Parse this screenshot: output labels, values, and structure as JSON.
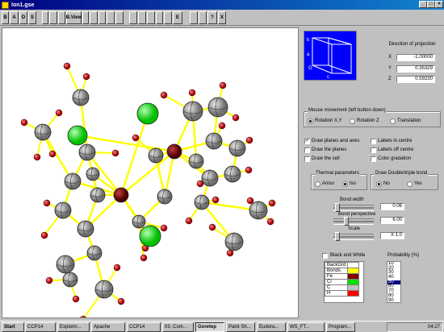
{
  "window": {
    "title": "lon1.gse"
  },
  "toolbar": {
    "buttons": [
      {
        "label": "B",
        "icon": "bond-icon"
      },
      {
        "label": "A",
        "icon": "atom-icon"
      },
      {
        "label": "D",
        "icon": "distance-icon"
      },
      {
        "label": "S",
        "icon": "symmetry-icon"
      },
      {
        "label": "",
        "icon": "cell-icon"
      },
      {
        "label": "",
        "icon": "rotate-x-icon"
      },
      {
        "label": "",
        "icon": "rotate-y-icon"
      },
      {
        "label": "B.View",
        "icon": "view-icon"
      },
      {
        "label": "",
        "icon": "flip-icon"
      },
      {
        "label": "",
        "icon": "mirror-icon"
      },
      {
        "label": "",
        "icon": "color-icon"
      },
      {
        "label": "",
        "icon": "select-icon"
      },
      {
        "label": "",
        "icon": "measure-icon"
      },
      {
        "label": "",
        "icon": "zoom-in-icon"
      },
      {
        "label": "",
        "icon": "zoom-out-icon"
      },
      {
        "label": "",
        "icon": "fit-icon"
      },
      {
        "label": "",
        "icon": "image-icon"
      },
      {
        "label": "",
        "icon": "render-icon"
      },
      {
        "label": "E",
        "icon": "export-icon"
      },
      {
        "label": "",
        "icon": "settings-icon"
      },
      {
        "label": "",
        "icon": "stop-icon"
      },
      {
        "label": "?",
        "icon": "help-icon"
      },
      {
        "label": "X",
        "icon": "close-icon"
      }
    ]
  },
  "projection": {
    "title": "Direction of projection",
    "x_label": "X",
    "x_value": "-1.00000",
    "y_label": "Y",
    "y_value": "0.35329",
    "z_label": "Z",
    "z_value": "0.59230",
    "cell_labels": [
      "b",
      "a",
      "O",
      "c"
    ]
  },
  "mouse": {
    "title": "Mouse movement (left button down)",
    "options": [
      "Rotation X,Y",
      "Rotation Z",
      "Translation"
    ],
    "selected": 0
  },
  "draw_options": {
    "left": [
      {
        "label": "Draw planes and axes",
        "checked": true
      },
      {
        "label": "Draw the planes",
        "checked": false
      },
      {
        "label": "Draw the cell",
        "checked": false
      }
    ],
    "right": [
      {
        "label": "Labels in centre",
        "checked": false
      },
      {
        "label": "Labels off centre",
        "checked": false
      },
      {
        "label": "Color gradation",
        "checked": false
      }
    ]
  },
  "thermal": {
    "title": "Thermal parameters",
    "options": [
      "Aniso",
      "Iso"
    ],
    "selected": 1
  },
  "double_bond": {
    "title": "Draw Double/triple bond",
    "options": [
      "No",
      "Yes"
    ],
    "selected": 0
  },
  "sliders": [
    {
      "label": "Bond width",
      "value": "0.06",
      "level": 0.05
    },
    {
      "label": "Bond perspective",
      "value": "6.00",
      "level": 0.3
    },
    {
      "label": "Scale",
      "value": "X 1.0",
      "level": 0.05
    }
  ],
  "bw": {
    "label": "Black and White",
    "checked": false
  },
  "color_key": {
    "rows": [
      {
        "label": "BackGrd",
        "color": "#ffffff"
      },
      {
        "label": "Bonds",
        "color": "#ffff00"
      },
      {
        "label": "Fe",
        "color": "#800000"
      },
      {
        "label": "Cl",
        "color": "#00e000"
      },
      {
        "label": "C",
        "color": "#c0c0c0"
      },
      {
        "label": "H",
        "color": "#ff0000"
      }
    ]
  },
  "probability": {
    "title": "Probability (%)",
    "options": [
      "10",
      "20",
      "30",
      "40",
      "50",
      "60",
      "70",
      "80",
      "90"
    ],
    "selected": "50"
  },
  "taskbar": {
    "start": "Start",
    "items": [
      {
        "label": "CCP14",
        "active": false
      },
      {
        "label": "Explorin...",
        "active": false
      },
      {
        "label": "Apache",
        "active": false
      },
      {
        "label": "CCP14",
        "active": false
      },
      {
        "label": "03. Com...",
        "active": false
      },
      {
        "label": "Goretep",
        "active": true
      },
      {
        "label": "Paint Sh...",
        "active": false
      },
      {
        "label": "Eudora...",
        "active": false
      },
      {
        "label": "WS_FT...",
        "active": false
      },
      {
        "label": "Program...",
        "active": false
      }
    ],
    "clock": "04:27"
  },
  "colors": {
    "titlebar": "#000080",
    "fe": "#800000",
    "cl": "#00e000",
    "c": "#909090",
    "h": "#cc0000",
    "bond": "#ffff00",
    "projection_bg": "#0000ff"
  }
}
